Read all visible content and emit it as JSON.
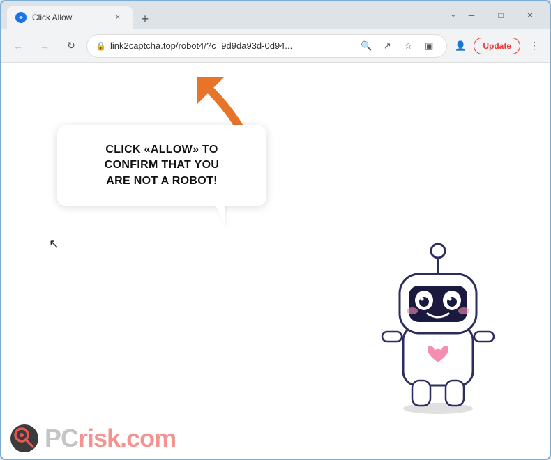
{
  "browser": {
    "tab_title": "Click Allow",
    "tab_close_label": "×",
    "new_tab_label": "+",
    "window_controls": {
      "minimize": "─",
      "maximize": "□",
      "close": "✕",
      "chevron": "⌄"
    }
  },
  "toolbar": {
    "back_label": "←",
    "forward_label": "→",
    "reload_label": "↻",
    "url": "link2captcha.top/robot4/?c=9d9da93d-0d94...",
    "search_icon": "🔍",
    "share_icon": "↗",
    "bookmark_icon": "☆",
    "sidebar_icon": "▣",
    "profile_icon": "👤",
    "update_label": "Update",
    "menu_icon": "⋮"
  },
  "page": {
    "bubble_line1": "CLICK «ALLOW» TO CONFIRM THAT YOU",
    "bubble_line2": "ARE NOT A ROBOT!"
  },
  "watermark": {
    "pc_text": "PC",
    "risk_text": "risk.com"
  }
}
